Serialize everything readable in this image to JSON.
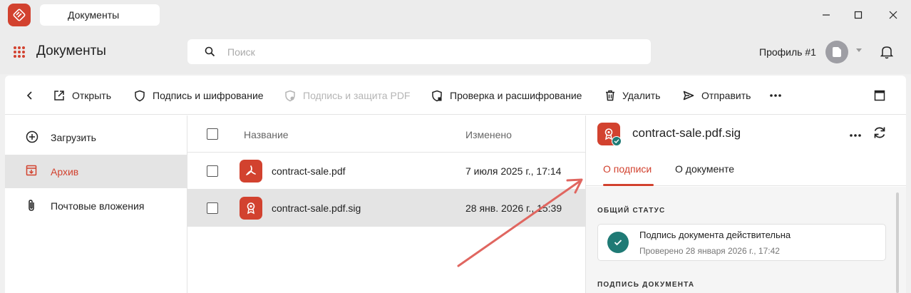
{
  "window": {
    "tab_title": "Документы",
    "minimize_icon": "minimize-icon",
    "maximize_icon": "maximize-icon",
    "close_icon": "close-icon"
  },
  "header": {
    "title": "Документы",
    "search_placeholder": "Поиск",
    "search_value": "",
    "profile_name": "Профиль #1"
  },
  "toolbar": {
    "back_icon": "chevron-left-icon",
    "open": "Открыть",
    "sign_encrypt": "Подпись и шифрование",
    "sign_protect_pdf": "Подпись и защита PDF",
    "verify_decrypt": "Проверка и расшифрование",
    "delete": "Удалить",
    "send": "Отправить"
  },
  "sidebar": {
    "items": [
      {
        "label": "Загрузить",
        "icon": "plus-circle-icon",
        "active": false
      },
      {
        "label": "Архив",
        "icon": "archive-icon",
        "active": true
      },
      {
        "label": "Почтовые вложения",
        "icon": "paperclip-icon",
        "active": false
      }
    ]
  },
  "filelist": {
    "columns": {
      "name": "Название",
      "modified": "Изменено"
    },
    "rows": [
      {
        "name": "contract-sale.pdf",
        "modified": "7 июля 2025 г., 17:14",
        "icon": "pdf-file-icon",
        "selected": false
      },
      {
        "name": "contract-sale.pdf.sig",
        "modified": "28 янв. 2026 г., 15:39",
        "icon": "signature-file-icon",
        "selected": true
      }
    ]
  },
  "details": {
    "title": "contract-sale.pdf.sig",
    "tabs": [
      {
        "label": "О подписи",
        "active": true
      },
      {
        "label": "О документе",
        "active": false
      }
    ],
    "overall_status_label": "ОБЩИЙ СТАТУС",
    "status_title": "Подпись документа действительна",
    "status_subtitle": "Проверено 28 января 2026 г., 17:42",
    "document_signature_label": "ПОДПИСЬ ДОКУМЕНТА"
  },
  "colors": {
    "accent": "#d2422f",
    "success": "#1f7a75",
    "annotation_arrow": "#e06660"
  }
}
